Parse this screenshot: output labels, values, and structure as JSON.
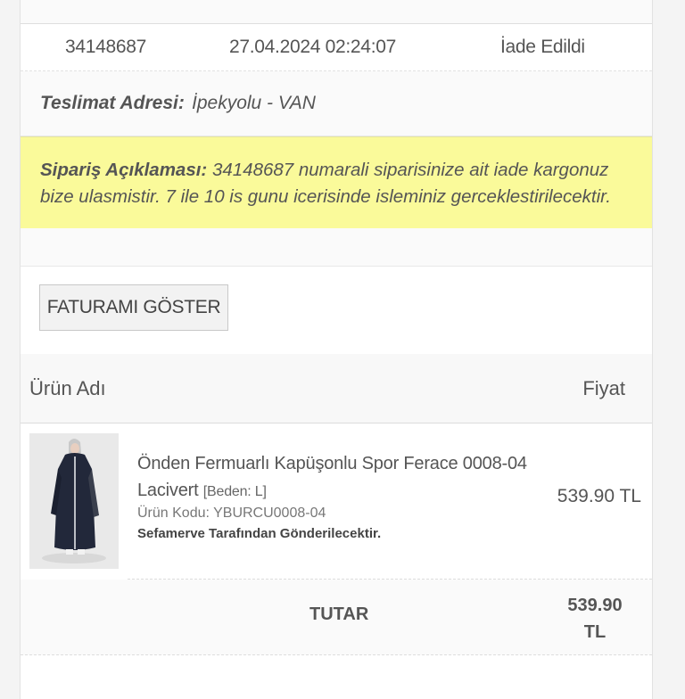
{
  "order": {
    "number": "34148687",
    "date": "27.04.2024 02:24:07",
    "status": "İade Edildi"
  },
  "address": {
    "label": "Teslimat Adresi:",
    "value": "İpekyolu - VAN"
  },
  "note": {
    "label": "Sipariş Açıklaması:",
    "text": "34148687 numarali siparisinize ait iade kargonuz bize ulasmistir. 7 ile 10 is gunu icerisinde isleminiz gerceklestirilecektir."
  },
  "invoice_button": "FATURAMI GÖSTER",
  "table": {
    "col_product": "Ürün Adı",
    "col_price": "Fiyat"
  },
  "product": {
    "name": "Önden Fermuarlı Kapüşonlu Spor Ferace 0008-04 Lacivert",
    "size": "[Beden: L]",
    "code": "Ürün Kodu: YBURCU0008-04",
    "sender": "Sefamerve Tarafından Gönderilecektir.",
    "price": "539.90 TL"
  },
  "total": {
    "label": "TUTAR",
    "value_amount": "539.90",
    "value_currency": "TL"
  },
  "colors": {
    "note_bg": "#fafa9a",
    "page_bg": "#ffffff"
  }
}
